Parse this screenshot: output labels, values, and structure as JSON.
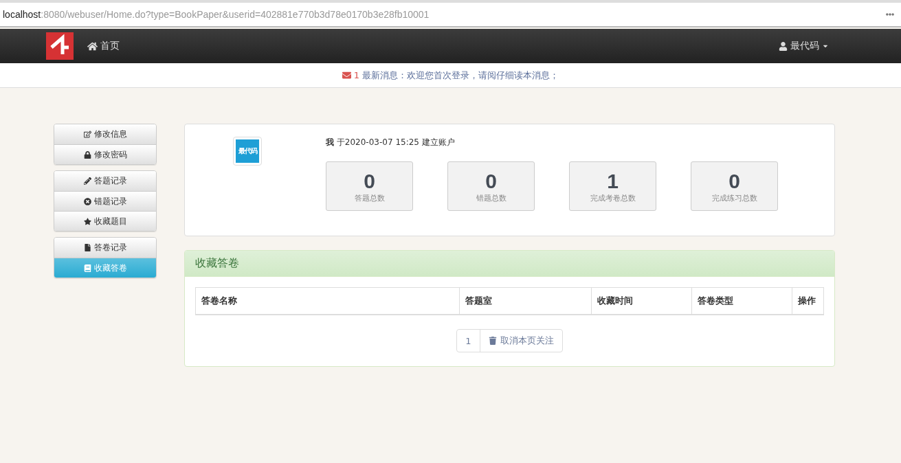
{
  "browser": {
    "address_host": "localhost",
    "address_rest": ":8080/webuser/Home.do?type=BookPaper&userid=402881e770b3d78e0170b3e28fb10001"
  },
  "navbar": {
    "home": "首页",
    "user": "最代码"
  },
  "notice": {
    "count": "1",
    "text": "最新消息：欢迎您首次登录，请阅仔细读本消息；"
  },
  "sidebar": {
    "groups": [
      {
        "items": [
          {
            "label": "修改信息",
            "selected": false
          },
          {
            "label": "修改密码",
            "selected": false
          }
        ]
      },
      {
        "items": [
          {
            "label": "答题记录",
            "selected": false
          },
          {
            "label": "错题记录",
            "selected": false
          },
          {
            "label": "收藏题目",
            "selected": false
          }
        ]
      },
      {
        "items": [
          {
            "label": "答卷记录",
            "selected": false
          },
          {
            "label": "收藏答卷",
            "selected": true
          }
        ]
      }
    ]
  },
  "profile": {
    "avatar_text": "最代码",
    "who": "我",
    "created": "于2020-03-07 15:25 建立账户",
    "stats": [
      {
        "value": "0",
        "label": "答题总数"
      },
      {
        "value": "0",
        "label": "错题总数"
      },
      {
        "value": "1",
        "label": "完成考卷总数"
      },
      {
        "value": "0",
        "label": "完成练习总数"
      }
    ]
  },
  "panel": {
    "title": "收藏答卷",
    "table": {
      "columns": [
        "答卷名称",
        "答题室",
        "收藏时间",
        "答卷类型",
        "操作"
      ]
    },
    "pagination": {
      "page": "1",
      "action": "取消本页关注"
    }
  }
}
